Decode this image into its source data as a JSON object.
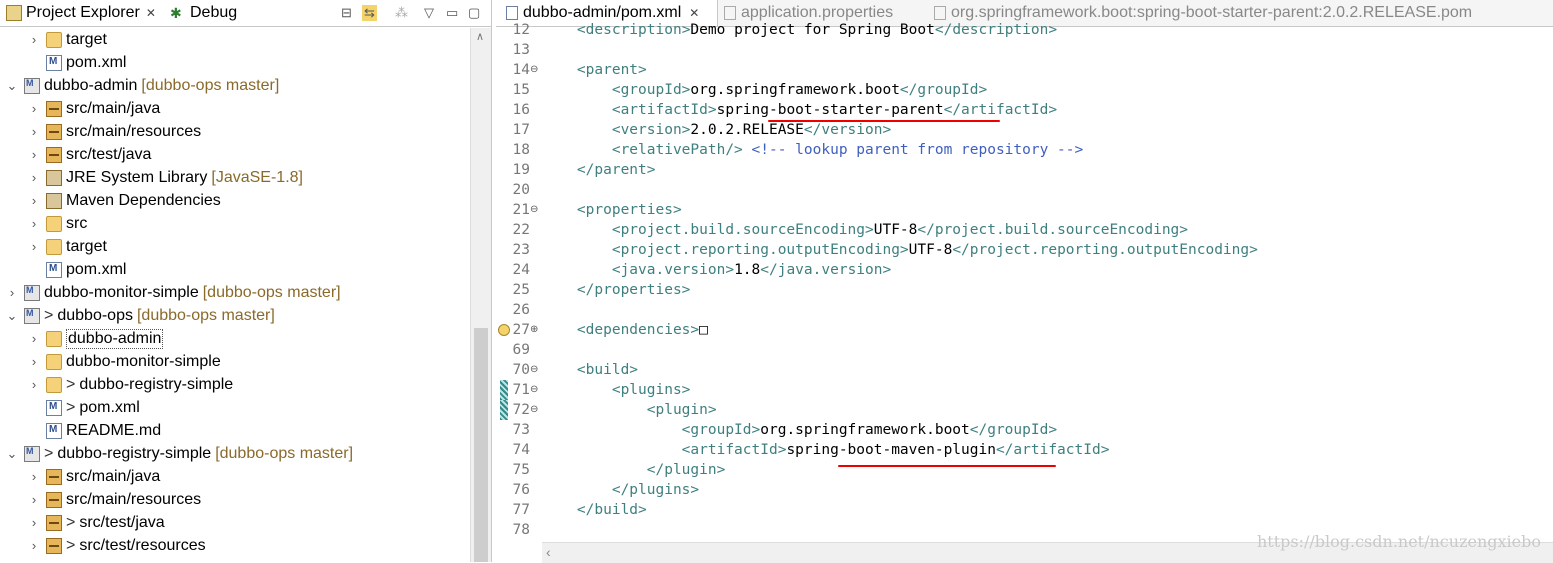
{
  "left_panel": {
    "tabs": [
      {
        "label": "Project Explorer",
        "close": "✕"
      },
      {
        "label": "Debug"
      }
    ],
    "tree": [
      {
        "chev": "›",
        "icon": "folder",
        "label": "target",
        "deco": "",
        "indent": 1
      },
      {
        "chev": "",
        "icon": "file",
        "label": "pom.xml",
        "deco": "",
        "indent": 1
      },
      {
        "chev": "⌄",
        "icon": "proj",
        "label": "dubbo-admin",
        "deco": "[dubbo-ops master]",
        "indent": 0
      },
      {
        "chev": "›",
        "icon": "pkg",
        "label": "src/main/java",
        "deco": "",
        "indent": 1
      },
      {
        "chev": "›",
        "icon": "pkg",
        "label": "src/main/resources",
        "deco": "",
        "indent": 1
      },
      {
        "chev": "›",
        "icon": "pkg",
        "label": "src/test/java",
        "deco": "",
        "indent": 1
      },
      {
        "chev": "›",
        "icon": "lib",
        "label": "JRE System Library",
        "deco": "[JavaSE-1.8]",
        "indent": 1
      },
      {
        "chev": "›",
        "icon": "lib",
        "label": "Maven Dependencies",
        "deco": "",
        "indent": 1
      },
      {
        "chev": "›",
        "icon": "folder",
        "label": "src",
        "deco": "",
        "indent": 1
      },
      {
        "chev": "›",
        "icon": "folder",
        "label": "target",
        "deco": "",
        "indent": 1
      },
      {
        "chev": "",
        "icon": "file",
        "label": "pom.xml",
        "deco": "",
        "indent": 1
      },
      {
        "chev": "›",
        "icon": "proj",
        "label": "dubbo-monitor-simple",
        "deco": "[dubbo-ops master]",
        "indent": 0
      },
      {
        "chev": "⌄",
        "icon": "proj",
        "label": "dubbo-ops",
        "prefix": ">",
        "deco": "[dubbo-ops master]",
        "indent": 0
      },
      {
        "chev": "›",
        "icon": "folder",
        "label": "dubbo-admin",
        "deco": "",
        "indent": 1,
        "selected": true
      },
      {
        "chev": "›",
        "icon": "folder",
        "label": "dubbo-monitor-simple",
        "deco": "",
        "indent": 1
      },
      {
        "chev": "›",
        "icon": "folder",
        "label": "dubbo-registry-simple",
        "prefix": ">",
        "deco": "",
        "indent": 1
      },
      {
        "chev": "",
        "icon": "file",
        "label": "pom.xml",
        "prefix": ">",
        "deco": "",
        "indent": 1
      },
      {
        "chev": "",
        "icon": "file",
        "label": "README.md",
        "deco": "",
        "indent": 1
      },
      {
        "chev": "⌄",
        "icon": "proj",
        "label": "dubbo-registry-simple",
        "prefix": ">",
        "deco": "[dubbo-ops master]",
        "indent": 0
      },
      {
        "chev": "›",
        "icon": "pkg",
        "label": "src/main/java",
        "deco": "",
        "indent": 1
      },
      {
        "chev": "›",
        "icon": "pkg",
        "label": "src/main/resources",
        "deco": "",
        "indent": 1
      },
      {
        "chev": "›",
        "icon": "pkg",
        "label": "src/test/java",
        "prefix": ">",
        "deco": "",
        "indent": 1
      },
      {
        "chev": "›",
        "icon": "pkg",
        "label": "src/test/resources",
        "prefix": ">",
        "deco": "",
        "indent": 1
      }
    ]
  },
  "editor": {
    "tabs": [
      {
        "label": "dubbo-admin/pom.xml",
        "active": true,
        "close": "✕"
      },
      {
        "label": "application.properties",
        "active": false
      },
      {
        "label": "org.springframework.boot:spring-boot-starter-parent:2.0.2.RELEASE.pom",
        "active": false
      }
    ],
    "lines": [
      {
        "n": "12",
        "fold": "",
        "segs": [
          [
            "t",
            "    <"
          ],
          [
            "t",
            "description"
          ],
          [
            "t",
            ">"
          ],
          [
            "v",
            "Demo project for Spring Boot"
          ],
          [
            "t",
            "</description>"
          ]
        ]
      },
      {
        "n": "13",
        "fold": "",
        "segs": []
      },
      {
        "n": "14",
        "fold": "⊖",
        "segs": [
          [
            "t",
            "    <parent>"
          ]
        ]
      },
      {
        "n": "15",
        "fold": "",
        "segs": [
          [
            "t",
            "        <groupId>"
          ],
          [
            "v",
            "org.springframework.boot"
          ],
          [
            "t",
            "</groupId>"
          ]
        ]
      },
      {
        "n": "16",
        "fold": "",
        "segs": [
          [
            "t",
            "        <artifactId>"
          ],
          [
            "v",
            "spring-boot-starter-parent"
          ],
          [
            "t",
            "</artifactId>"
          ]
        ]
      },
      {
        "n": "17",
        "fold": "",
        "segs": [
          [
            "t",
            "        <version>"
          ],
          [
            "v",
            "2.0.2.RELEASE"
          ],
          [
            "t",
            "</version>"
          ]
        ]
      },
      {
        "n": "18",
        "fold": "",
        "segs": [
          [
            "t",
            "        <relativePath/> "
          ],
          [
            "c",
            "<!-- lookup parent from repository -->"
          ]
        ]
      },
      {
        "n": "19",
        "fold": "",
        "segs": [
          [
            "t",
            "    </parent>"
          ]
        ]
      },
      {
        "n": "20",
        "fold": "",
        "segs": []
      },
      {
        "n": "21",
        "fold": "⊖",
        "segs": [
          [
            "t",
            "    <properties>"
          ]
        ]
      },
      {
        "n": "22",
        "fold": "",
        "segs": [
          [
            "t",
            "        <project.build.sourceEncoding>"
          ],
          [
            "v",
            "UTF-8"
          ],
          [
            "t",
            "</project.build.sourceEncoding>"
          ]
        ]
      },
      {
        "n": "23",
        "fold": "",
        "segs": [
          [
            "t",
            "        <project.reporting.outputEncoding>"
          ],
          [
            "v",
            "UTF-8"
          ],
          [
            "t",
            "</project.reporting.outputEncoding>"
          ]
        ]
      },
      {
        "n": "24",
        "fold": "",
        "segs": [
          [
            "t",
            "        <java.version>"
          ],
          [
            "v",
            "1.8"
          ],
          [
            "t",
            "</java.version>"
          ]
        ]
      },
      {
        "n": "25",
        "fold": "",
        "segs": [
          [
            "t",
            "    </properties>"
          ]
        ]
      },
      {
        "n": "26",
        "fold": "",
        "segs": []
      },
      {
        "n": "27",
        "fold": "⊕",
        "segs": [
          [
            "t",
            "    <dependencies>"
          ],
          [
            "v",
            "□"
          ]
        ]
      },
      {
        "n": "69",
        "fold": "",
        "segs": []
      },
      {
        "n": "70",
        "fold": "⊖",
        "segs": [
          [
            "t",
            "    <build>"
          ]
        ]
      },
      {
        "n": "71",
        "fold": "⊖",
        "segs": [
          [
            "t",
            "        <plugins>"
          ]
        ]
      },
      {
        "n": "72",
        "fold": "⊖",
        "segs": [
          [
            "t",
            "            <plugin>"
          ]
        ]
      },
      {
        "n": "73",
        "fold": "",
        "segs": [
          [
            "t",
            "                <groupId>"
          ],
          [
            "v",
            "org.springframework.boot"
          ],
          [
            "t",
            "</groupId>"
          ]
        ]
      },
      {
        "n": "74",
        "fold": "",
        "segs": [
          [
            "t",
            "                <artifactId>"
          ],
          [
            "v",
            "spring-boot-maven-plugin"
          ],
          [
            "t",
            "</artifactId>"
          ]
        ]
      },
      {
        "n": "75",
        "fold": "",
        "segs": [
          [
            "t",
            "            </plugin>"
          ]
        ]
      },
      {
        "n": "76",
        "fold": "",
        "segs": [
          [
            "t",
            "        </plugins>"
          ]
        ]
      },
      {
        "n": "77",
        "fold": "",
        "segs": [
          [
            "t",
            "    </build>"
          ]
        ]
      },
      {
        "n": "78",
        "fold": "",
        "segs": []
      }
    ],
    "watermark": "https://blog.csdn.net/ncuzengxiebo"
  },
  "colors": {
    "tag": "#3f7f7f",
    "comment": "#3f5fbf",
    "annotation": "#e00000"
  }
}
